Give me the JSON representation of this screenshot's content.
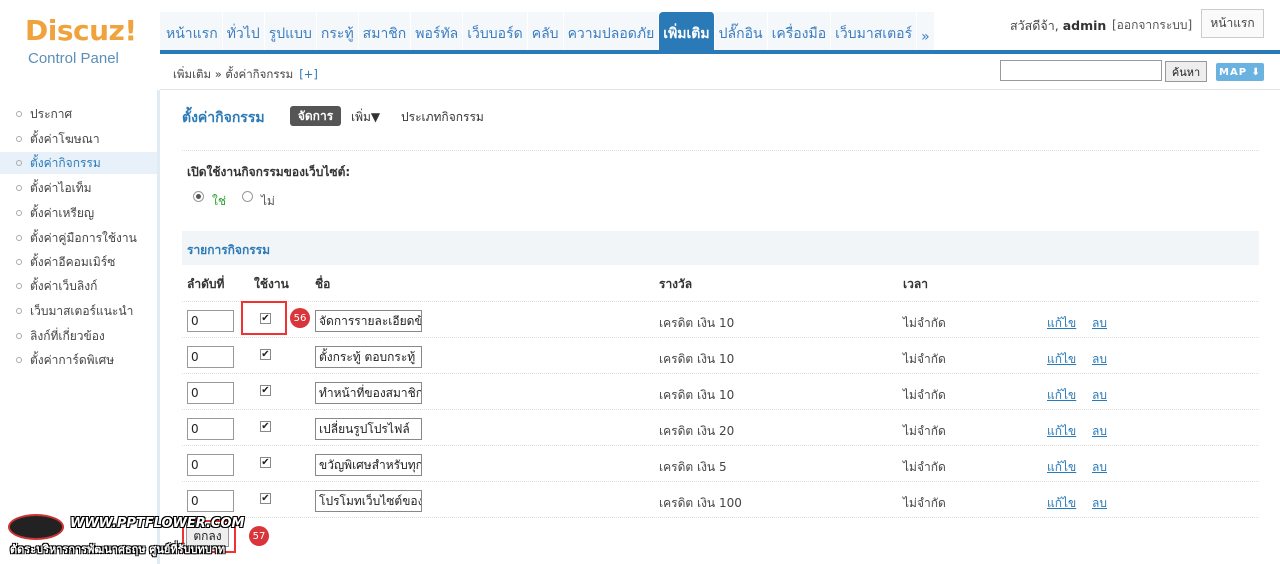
{
  "logo": {
    "word": "Discuz!",
    "sub": "Control Panel"
  },
  "nav": {
    "tabs": [
      {
        "label": "หน้าแรก"
      },
      {
        "label": "ทั่วไป"
      },
      {
        "label": "รูปแบบ"
      },
      {
        "label": "กระทู้"
      },
      {
        "label": "สมาชิก"
      },
      {
        "label": "พอร์ทัล"
      },
      {
        "label": "เว็บบอร์ด"
      },
      {
        "label": "คลับ"
      },
      {
        "label": "ความปลอดภัย"
      },
      {
        "label": "เพิ่มเติม"
      },
      {
        "label": "ปลั๊กอิน"
      },
      {
        "label": "เครื่องมือ"
      },
      {
        "label": "เว็บมาสเตอร์"
      },
      {
        "label": "»"
      }
    ],
    "active_index": 9
  },
  "user": {
    "greeting": "สวัสดีจ้า,",
    "name": "admin",
    "logout": "[ออกจากระบบ]",
    "home": "หน้าแรก"
  },
  "subbar": {
    "breadcrumb": "เพิ่มเติม » ตั้งค่ากิจกรรม",
    "plus": "[+]",
    "search_button": "ค้นหา",
    "map_label": "MAP ⬇"
  },
  "sidebar": {
    "items": [
      {
        "label": "ประกาศ"
      },
      {
        "label": "ตั้งค่าโฆษณา"
      },
      {
        "label": "ตั้งค่ากิจกรรม"
      },
      {
        "label": "ตั้งค่าไอเท็ม"
      },
      {
        "label": "ตั้งค่าเหรียญ"
      },
      {
        "label": "ตั้งค่าคู่มือการใช้งาน"
      },
      {
        "label": "ตั้งค่าอีคอมเมิร์ซ"
      },
      {
        "label": "ตั้งค่าเว็บลิงก์"
      },
      {
        "label": "เว็บมาสเตอร์แนะนำ"
      },
      {
        "label": "ลิงก์ที่เกี่ยวข้อง"
      },
      {
        "label": "ตั้งค่าการ์ดพิเศษ"
      }
    ],
    "active_index": 2
  },
  "main": {
    "title": "ตั้งค่ากิจกรรม",
    "tab_manage": "จัดการ",
    "tab_add": "เพิ่ม▼",
    "tab_types": "ประเภทกิจกรรม",
    "enable_label": "เปิดใช้งานกิจกรรมของเว็บไซต์:",
    "radio_yes": "ใช่",
    "radio_no": "ไม่",
    "enabled": true,
    "list_title": "รายการกิจกรรม",
    "columns": {
      "order": "ลำดับที่",
      "enabled": "ใช้งาน",
      "name": "ชื่อ",
      "reward": "รางวัล",
      "time": "เวลา"
    },
    "rows": [
      {
        "order": "0",
        "enabled": true,
        "name": "จัดการรายละเอียดข้อ",
        "reward": "เครดิต เงิน 10",
        "time": "ไม่จำกัด",
        "edit": "แก้ไข",
        "delete": "ลบ"
      },
      {
        "order": "0",
        "enabled": true,
        "name": "ตั้งกระทู้ ตอบกระทู้",
        "reward": "เครดิต เงิน 10",
        "time": "ไม่จำกัด",
        "edit": "แก้ไข",
        "delete": "ลบ"
      },
      {
        "order": "0",
        "enabled": true,
        "name": "ทำหน้าที่ของสมาชิก",
        "reward": "เครดิต เงิน 10",
        "time": "ไม่จำกัด",
        "edit": "แก้ไข",
        "delete": "ลบ"
      },
      {
        "order": "0",
        "enabled": true,
        "name": "เปลี่ยนรูปโปรไฟล์",
        "reward": "เครดิต เงิน 20",
        "time": "ไม่จำกัด",
        "edit": "แก้ไข",
        "delete": "ลบ"
      },
      {
        "order": "0",
        "enabled": true,
        "name": "ขวัญพิเศษสำหรับทุก",
        "reward": "เครดิต เงิน 5",
        "time": "ไม่จำกัด",
        "edit": "แก้ไข",
        "delete": "ลบ"
      },
      {
        "order": "0",
        "enabled": true,
        "name": "โปรโมทเว็บไซต์ของ",
        "reward": "เครดิต เงิน 100",
        "time": "ไม่จำกัด",
        "edit": "แก้ไข",
        "delete": "ลบ"
      }
    ],
    "submit": "ตกลง"
  },
  "markers": {
    "m56": "56",
    "m57": "57"
  },
  "watermark": {
    "url": "WWW.PPTFLOWER.COM",
    "line": "ตัดระบริหารการพัฒนาศธฤษ ศูนย์ที่รับบทบาท"
  },
  "colors": {
    "accent": "#2b7ab8",
    "marker": "#d8363b",
    "logo": "#f0a33c"
  }
}
